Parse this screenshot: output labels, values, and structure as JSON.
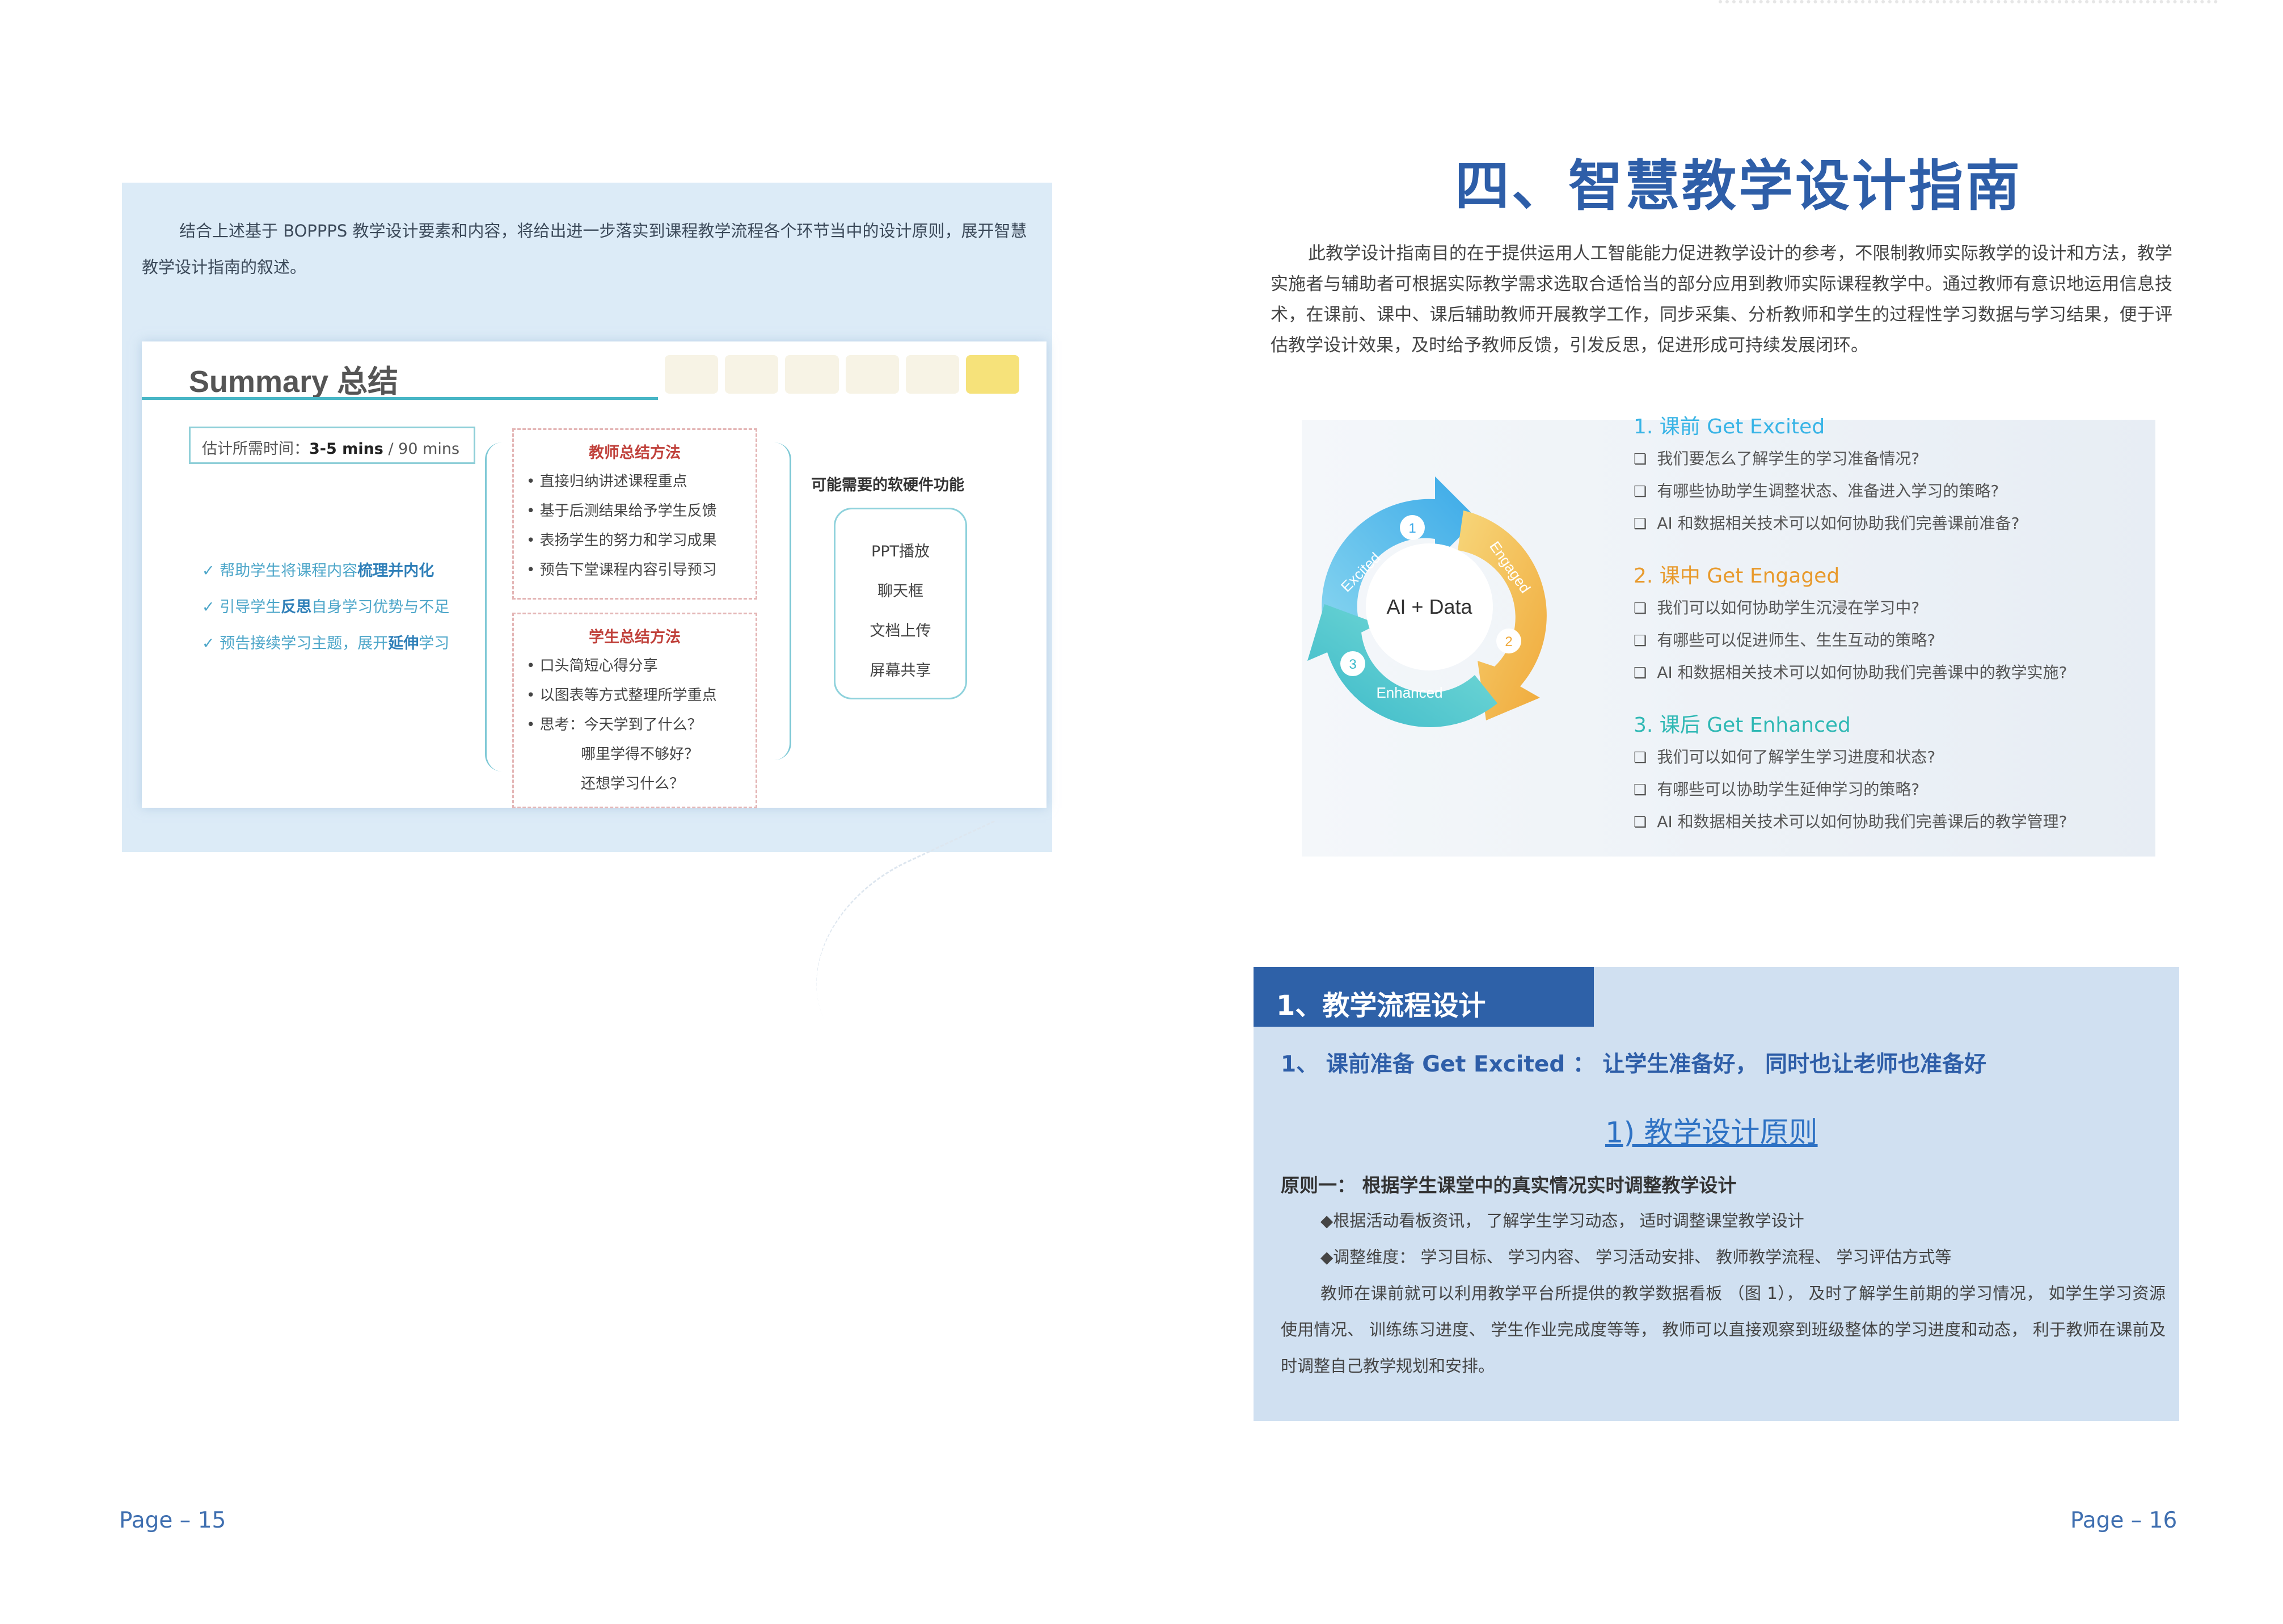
{
  "left_page": {
    "intro": "结合上述基于 BOPPPS 教学设计要素和内容，将给出进一步落实到课程教学流程各个环节当中的设计原则，展开智慧教学设计指南的叙述。",
    "slide": {
      "title": "Summary 总结",
      "time_label": "估计所需时间：",
      "time_value": "3-5 mins",
      "time_total": " / 90 mins",
      "goals": [
        {
          "pre": "帮助学生将课程内容",
          "bold": "梳理并内化",
          "post": ""
        },
        {
          "pre": "引导学生",
          "bold": "反思",
          "post": "自身学习优势与不足"
        },
        {
          "pre": "预告接续学习主题，展开",
          "bold": "延伸",
          "post": "学习"
        }
      ],
      "teacher_box": {
        "title": "教师总结方法",
        "items": [
          "• 直接归纳讲述课程重点",
          "• 基于后测结果给予学生反馈",
          "• 表扬学生的努力和学习成果",
          "• 预告下堂课程内容引导预习"
        ]
      },
      "student_box": {
        "title": "学生总结方法",
        "items": [
          "• 口头简短心得分享",
          "• 以图表等方式整理所学重点",
          "• 思考：今天学到了什么？"
        ],
        "indented": [
          "哪里学得不够好？",
          "还想学习什么？"
        ]
      },
      "software_title": "可能需要的软硬件功能",
      "software_items": [
        "PPT播放",
        "聊天框",
        "文档上传",
        "屏幕共享"
      ]
    },
    "page_number": "Page – 15"
  },
  "right_page": {
    "heading": "四、智慧教学设计指南",
    "intro": "此教学设计指南目的在于提供运用人工智能能力促进教学设计的参考，不限制教师实际教学的设计和方法，教学实施者与辅助者可根据实际教学需求选取合适恰当的部分应用到教师实际课程教学中。通过教师有意识地运用信息技术，在课前、课中、课后辅助教师开展教学工作，同步采集、分析教师和学生的过程性学习数据与学习结果，便于评估教学设计效果，及时给予教师反馈，引发反思，促进形成可持续发展闭环。",
    "cycle": {
      "center": "AI + Data",
      "labels": [
        "Excited",
        "Engaged",
        "Enhanced"
      ],
      "numbers": [
        "1",
        "2",
        "3"
      ],
      "colors": {
        "excited": "#5bc2e7",
        "engaged": "#f2b84b",
        "enhanced": "#47c4c4"
      }
    },
    "steps": [
      {
        "title": "1. 课前 Get Excited",
        "color": "#38b4e6",
        "questions": [
          "我们要怎么了解学生的学习准备情况?",
          "有哪些协助学生调整状态、准备进入学习的策略?",
          "AI 和数据相关技术可以如何协助我们完善课前准备?"
        ]
      },
      {
        "title": "2. 课中 Get Engaged",
        "color": "#e89a2c",
        "questions": [
          "我们可以如何协助学生沉浸在学习中?",
          "有哪些可以促进师生、生生互动的策略?",
          "AI 和数据相关技术可以如何协助我们完善课中的教学实施?"
        ]
      },
      {
        "title": "3. 课后 Get Enhanced",
        "color": "#2fb8b4",
        "questions": [
          "我们可以如何了解学生学习进度和状态?",
          "有哪些可以协助学生延伸学习的策略?",
          "AI 和数据相关技术可以如何协助我们完善课后的教学管理?"
        ]
      }
    ],
    "section": {
      "tab": "1、教学流程设计",
      "subtitle": "1、 课前准备 Get Excited ： 让学生准备好， 同时也让老师也准备好",
      "h3": "1) 教学设计原则",
      "principle": "原则一： 根据学生课堂中的真实情况实时调整教学设计",
      "bullets": [
        "◆根据活动看板资讯， 了解学生学习动态， 适时调整课堂教学设计",
        "◆调整维度： 学习目标、 学习内容、 学习活动安排、 教师教学流程、 学习评估方式等"
      ],
      "paragraph": "教师在课前就可以利用教学平台所提供的教学数据看板 （图 1）， 及时了解学生前期的学习情况， 如学生学习资源使用情况、 训练练习进度、 学生作业完成度等等， 教师可以直接观察到班级整体的学习进度和动态， 利于教师在课前及时调整自己教学规划和安排。"
    },
    "page_number": "Page – 16"
  },
  "colors": {
    "brand_blue": "#2e5ea8",
    "accent_teal": "#48b6c6",
    "panel_blue": "#d0e0f1"
  }
}
